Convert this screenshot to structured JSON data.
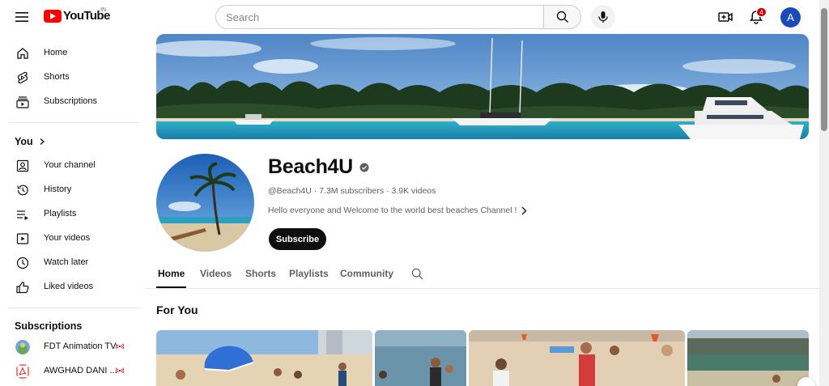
{
  "header": {
    "logo_text": "YouTube",
    "country_code": "IN",
    "search_placeholder": "Search",
    "notification_count": "4",
    "avatar_letter": "A"
  },
  "sidebar": {
    "main_items": [
      {
        "label": "Home",
        "icon": "home-icon"
      },
      {
        "label": "Shorts",
        "icon": "shorts-icon"
      },
      {
        "label": "Subscriptions",
        "icon": "subscriptions-icon"
      }
    ],
    "you_heading": "You",
    "you_items": [
      {
        "label": "Your channel",
        "icon": "your-channel-icon"
      },
      {
        "label": "History",
        "icon": "history-icon"
      },
      {
        "label": "Playlists",
        "icon": "playlists-icon"
      },
      {
        "label": "Your videos",
        "icon": "your-videos-icon"
      },
      {
        "label": "Watch later",
        "icon": "watch-later-icon"
      },
      {
        "label": "Liked videos",
        "icon": "liked-videos-icon"
      }
    ],
    "subscriptions_heading": "Subscriptions",
    "subscriptions": [
      {
        "label": "FDT Animation TV",
        "live": true
      },
      {
        "label": "AWGHAD DANI ...",
        "live": true
      }
    ]
  },
  "channel": {
    "name": "Beach4U",
    "handle": "@Beach4U",
    "subscribers": "7.3M subscribers",
    "videos": "3.9K videos",
    "separator": "·",
    "description": "Hello everyone and Welcome to the world best beaches Channel !",
    "subscribe_label": "Subscribe"
  },
  "tabs": [
    {
      "label": "Home",
      "active": true
    },
    {
      "label": "Videos",
      "active": false
    },
    {
      "label": "Shorts",
      "active": false
    },
    {
      "label": "Playlists",
      "active": false
    },
    {
      "label": "Community",
      "active": false
    }
  ],
  "section": {
    "title": "For You"
  },
  "colors": {
    "brand_red": "#ff0000",
    "avatar_blue": "#1a4bb8",
    "text_primary": "#0f0f0f",
    "text_secondary": "#606060",
    "live_red": "#cc0000"
  }
}
